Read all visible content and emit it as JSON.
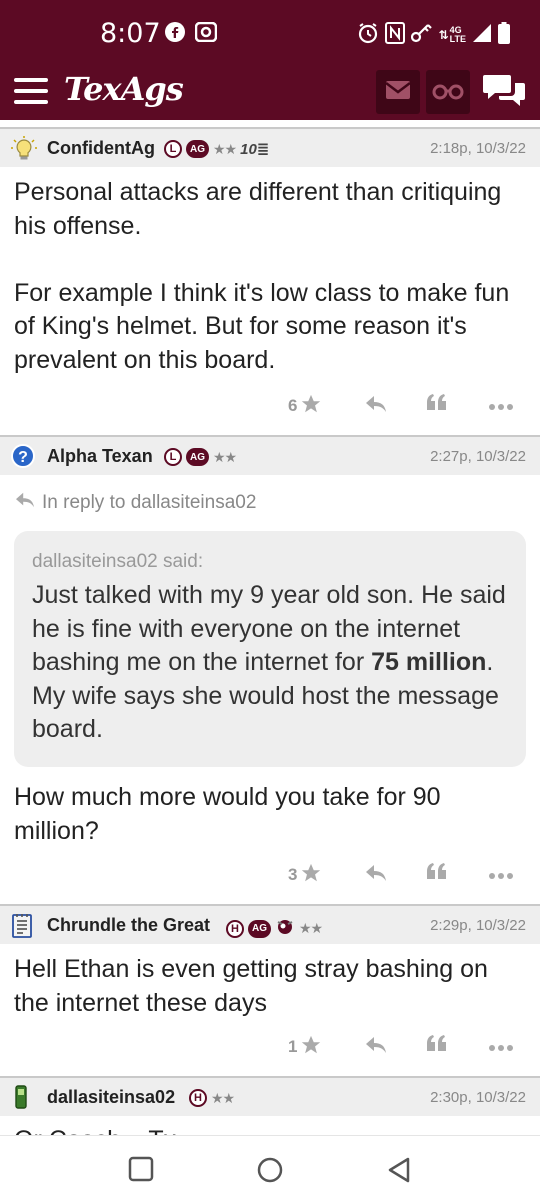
{
  "status_bar": {
    "time": "8:07",
    "network": "4G LTE"
  },
  "header": {
    "logo": "TexAgs"
  },
  "posts": [
    {
      "username": "ConfidentAg",
      "badges": [
        "L",
        "AG"
      ],
      "stars": "★★",
      "rank": "10≣",
      "time": "2:18p, 10/3/22",
      "body": "Personal attacks are different than critiquing his offense.\n\nFor example I think it's low class to make fun of King's helmet. But for some reason it's prevalent on this board.",
      "star_count": "6"
    },
    {
      "username": "Alpha Texan",
      "badges": [
        "L",
        "AG"
      ],
      "stars": "★★",
      "time": "2:27p, 10/3/22",
      "reply_to": "In reply to dallasiteinsa02",
      "quote_author": "dallasiteinsa02 said:",
      "quote_before": "Just talked with my 9 year old son. He said he is fine with everyone on the internet bashing me on the internet for ",
      "quote_bold": "75 million",
      "quote_after": ". My wife says she would host the message board.",
      "body": "How much more would you take for 90 million?",
      "star_count": "3"
    },
    {
      "username": "Chrundle the Great",
      "badges": [
        "H",
        "AG"
      ],
      "stars": "★★",
      "time": "2:29p, 10/3/22",
      "body": "Hell Ethan is even getting stray bashing on the internet these days",
      "star_count": "1"
    },
    {
      "username": "dallasiteinsa02",
      "badges": [
        "H"
      ],
      "stars": "★★",
      "time": "2:30p, 10/3/22",
      "body": "Or Coach... Tx..."
    }
  ],
  "colors": {
    "brand": "#5c0a24",
    "header_bg": "#eeeeee",
    "muted": "#888888"
  }
}
